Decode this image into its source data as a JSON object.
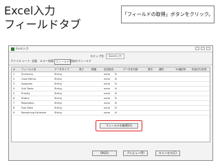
{
  "heading": {
    "line1": "Excel入力",
    "line2": "フィールドタブ"
  },
  "callout": "「フィールドの取得」ボタンをクリック。",
  "window": {
    "title": "Excel入力",
    "step_label": "ステップ名",
    "step_name": "Excel入力",
    "tabs": [
      "ファイル",
      "シート",
      "全般",
      "エラー処理",
      "フィールド",
      "追加のフィールド"
    ],
    "active_tab": 4,
    "grid": {
      "headers": [
        "#",
        "フィールド名",
        "データタイプ",
        "長さ",
        "精度",
        "空白除去",
        "データを内部",
        "書式",
        "通貨",
        "10進記号",
        "桁区切り記号"
      ],
      "rows": [
        [
          "1",
          "Summary",
          "String",
          "",
          "",
          "none",
          "N"
        ],
        [
          "2",
          "Case Memo",
          "String",
          "",
          "",
          "none",
          "N"
        ],
        [
          "3",
          "Assignee",
          "String",
          "",
          "",
          "none",
          "N"
        ],
        [
          "4",
          "Sub Tasks",
          "String",
          "",
          "",
          "none",
          "N"
        ],
        [
          "5",
          "Priority",
          "String",
          "",
          "",
          "none",
          "N"
        ],
        [
          "6",
          "Status",
          "String",
          "",
          "",
          "none",
          "N"
        ],
        [
          "7",
          "Resolution",
          "String",
          "",
          "",
          "none",
          "N"
        ],
        [
          "8",
          "Due Date",
          "String",
          "",
          "",
          "none",
          "N"
        ],
        [
          "9",
          "Remaining Estimate",
          "String",
          "",
          "",
          "none",
          "N"
        ]
      ]
    },
    "buttons": {
      "fetch": "フィールドの取得(G)",
      "ok": "OK(O)",
      "preview": "プレビュー(P)",
      "cancel": "キャンセル(C)"
    }
  }
}
